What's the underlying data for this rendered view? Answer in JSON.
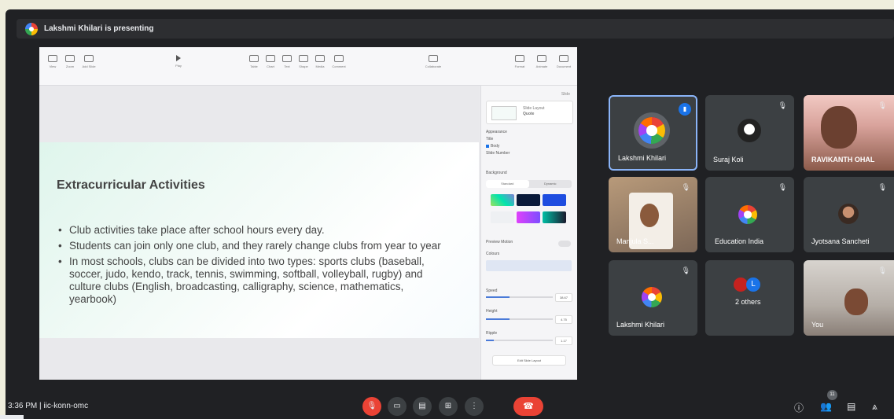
{
  "banner": {
    "presenter_text": "Lakshmi Khilari is presenting"
  },
  "slides_app": {
    "toolbar": [
      "View",
      "Zoom",
      "Add Slide",
      "Play",
      "Table",
      "Chart",
      "Text",
      "Shape",
      "Media",
      "Comment",
      "Collaborate",
      "Format",
      "Animate",
      "Document"
    ],
    "inspector": {
      "header": "Slide",
      "layout_label": "Slide Layout",
      "layout_value": "Quote",
      "appearance": "Appearance",
      "title_opt": "Title",
      "body_opt": "Body",
      "slide_number_opt": "Slide Number",
      "background": "Background",
      "standard": "Standard",
      "dynamic": "Dynamic",
      "preview_motion": "Preview Motion",
      "colours": "Colours",
      "speed": "Speed",
      "speed_value": "38.67",
      "height": "Height",
      "height_value": "4.75",
      "ripple": "Ripple",
      "ripple_value": "1.17",
      "edit_button": "Edit Slide Layout"
    },
    "slide": {
      "title": "Extracurricular Activities",
      "bullets": [
        "Club activities take place after school hours every day.",
        "Students can join only one club, and they rarely change clubs from year to year",
        "In most schools, clubs can be divided into two types: sports clubs (baseball, soccer, judo, kendo, track, tennis, swimming, softball, volleyball, rugby) and culture clubs (English, broadcasting, calligraphy, science, mathematics, yearbook)"
      ]
    }
  },
  "participants": [
    {
      "name": "Lakshmi Khilari",
      "avatar": "org-logo",
      "speaking": true
    },
    {
      "name": "Suraj Koli",
      "avatar": "photo",
      "muted": true
    },
    {
      "name": "RAVIKANTH OHAL",
      "avatar": "video",
      "muted": true
    },
    {
      "name": "Manjula S...",
      "avatar": "video",
      "muted": true
    },
    {
      "name": "Education India",
      "avatar": "org-logo",
      "muted": true
    },
    {
      "name": "Jyotsana Sancheti",
      "avatar": "photo",
      "muted": true
    },
    {
      "name": "Lakshmi Khilari",
      "avatar": "org-logo",
      "muted": true
    },
    {
      "name": "2 others",
      "avatar": "group"
    },
    {
      "name": "You",
      "avatar": "video",
      "muted": true
    }
  ],
  "others_initial": "L",
  "bottom_bar": {
    "time": "3:36 PM",
    "separator": "|",
    "meeting_code": "iic-konn-omc",
    "participant_count": "11"
  },
  "colors": {
    "accent": "#1a73e8",
    "danger": "#ea4335",
    "tile": "#3c4043",
    "background": "#202124"
  }
}
